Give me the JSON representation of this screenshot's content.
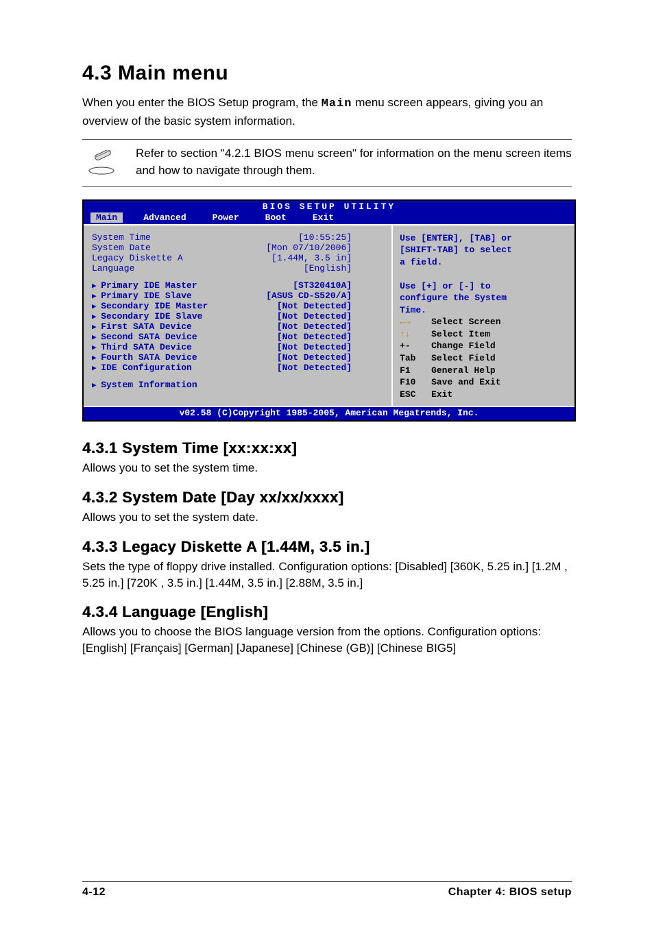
{
  "heading": "4.3    Main menu",
  "intro_before": "When you enter the BIOS Setup program, the ",
  "intro_bold": "Main",
  "intro_after": " menu screen appears, giving you an overview of the basic system information.",
  "note": "Refer to section \"4.2.1  BIOS menu screen\" for information on the menu screen items and how to navigate through them.",
  "bios": {
    "title": "BIOS SETUP UTILITY",
    "tabs": [
      "Main",
      "Advanced",
      "Power",
      "Boot",
      "Exit"
    ],
    "tabs_selected_index": 0,
    "rows_plain": [
      {
        "label": "System Time",
        "value": "[10:55:25]"
      },
      {
        "label": "System Date",
        "value": "[Mon 07/10/2006]"
      },
      {
        "label": "Legacy Diskette A",
        "value": "[1.44M, 3.5 in]"
      },
      {
        "label": "Language",
        "value": "[English]"
      }
    ],
    "rows_sub1": [
      {
        "label": "Primary IDE Master",
        "value": "[ST320410A]"
      },
      {
        "label": "Primary IDE Slave",
        "value": "[ASUS CD-S520/A]"
      },
      {
        "label": "Secondary IDE Master",
        "value": "[Not Detected]"
      },
      {
        "label": "Secondary IDE Slave",
        "value": "[Not Detected]"
      },
      {
        "label": "First SATA Device",
        "value": "[Not Detected]"
      },
      {
        "label": "Second SATA Device",
        "value": "[Not Detected]"
      },
      {
        "label": "Third SATA Device",
        "value": "[Not Detected]"
      },
      {
        "label": "Fourth SATA Device",
        "value": "[Not Detected]"
      },
      {
        "label": "IDE Configuration",
        "value": "[Not Detected]"
      }
    ],
    "rows_sub2": [
      {
        "label": "System Information",
        "value": ""
      }
    ],
    "help_lines": [
      "Use [ENTER], [TAB] or",
      "[SHIFT-TAB] to select",
      "a field.",
      "",
      "Use [+] or [-] to",
      "configure the System",
      "Time."
    ],
    "keys": [
      {
        "k": "←→",
        "d": "Select Screen",
        "yellow": true
      },
      {
        "k": "↑↓",
        "d": "Select Item",
        "yellow": true
      },
      {
        "k": "+-",
        "d": "Change Field"
      },
      {
        "k": "Tab",
        "d": "Select Field"
      },
      {
        "k": "F1",
        "d": "General Help"
      },
      {
        "k": "F10",
        "d": "Save and Exit"
      },
      {
        "k": "ESC",
        "d": "Exit"
      }
    ],
    "footer": "v02.58 (C)Copyright 1985-2005, American Megatrends, Inc."
  },
  "sections": [
    {
      "h": "4.3.1   System Time [xx:xx:xx]",
      "b": "Allows you to set the system time."
    },
    {
      "h": "4.3.2   System Date [Day xx/xx/xxxx]",
      "b": "Allows you to set the system date."
    },
    {
      "h": "4.3.3   Legacy Diskette A [1.44M, 3.5 in.]",
      "b": "Sets the type of floppy drive installed. Configuration options: [Disabled] [360K, 5.25 in.] [1.2M , 5.25 in.] [720K , 3.5 in.] [1.44M, 3.5 in.] [2.88M, 3.5 in.]"
    },
    {
      "h": "4.3.4   Language [English]",
      "b": "Allows you to choose the BIOS language version from the options. Configuration options:  [English] [Français] [German] [Japanese] [Chinese (GB)] [Chinese BIG5]"
    }
  ],
  "footer_left": "4-12",
  "footer_right": "Chapter 4: BIOS setup"
}
